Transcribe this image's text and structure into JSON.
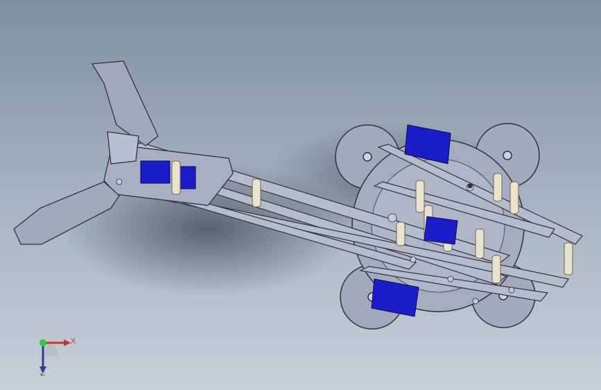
{
  "viewport": {
    "background_top": "#7f8fa1",
    "background_bottom": "#c7cfd8"
  },
  "model": {
    "body_color": "#9aa0b4",
    "body_edge_color": "#2e3140",
    "servo_color": "#1c1cc8",
    "spacer_color": "#e9e2cf"
  },
  "triad": {
    "x_label": "X",
    "z_label": "Z",
    "x_color": "#c0392b",
    "y_color": "#2ecc40",
    "z_color": "#2c3e8c"
  }
}
